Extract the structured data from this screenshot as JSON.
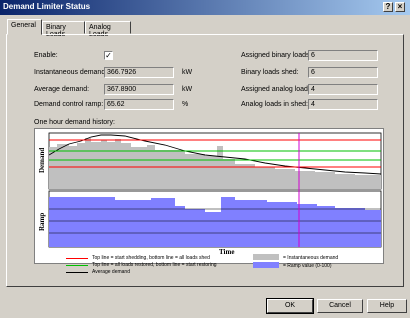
{
  "window": {
    "title": "Demand Limiter Status",
    "help_glyph": "?",
    "close_glyph": "×"
  },
  "tabs": [
    "General",
    "Binary Loads",
    "Analog Loads"
  ],
  "left_fields": {
    "enable_label": "Enable:",
    "enable_checked": true,
    "instantaneous_label": "Instantaneous demand:",
    "instantaneous_value": "366.7926",
    "instantaneous_unit": "kW",
    "average_label": "Average demand:",
    "average_value": "367.8900",
    "average_unit": "kW",
    "ramp_label": "Demand control ramp:",
    "ramp_value": "65.62",
    "ramp_unit": "%"
  },
  "right_fields": {
    "assigned_binary_label": "Assigned binary loads:",
    "assigned_binary_value": "6",
    "binary_shed_label": "Binary loads shed:",
    "binary_shed_value": "6",
    "assigned_analog_label": "Assigned analog loads:",
    "assigned_analog_value": "4",
    "analog_shed_label": "Analog loads in shed:",
    "analog_shed_value": "4"
  },
  "history_label": "One hour demand history:",
  "chart": {
    "y1_label": "Demand",
    "y2_label": "Ramp",
    "x_label": "Time",
    "legend": {
      "red": "Top line = start shedding, bottom line = all loads shed",
      "green": "Top line = all loads restored, bottom line = start restoring",
      "black": "Average demand",
      "grey": "= Instantaneous demand",
      "blue": "= Ramp value (0-100)"
    },
    "colors": {
      "grey": "#c0c0c0",
      "blue": "#8080ff",
      "red": "#ff0000",
      "green": "#00c000",
      "magenta": "#d000d0"
    }
  },
  "buttons": {
    "ok": "OK",
    "cancel": "Cancel",
    "help": "Help"
  }
}
